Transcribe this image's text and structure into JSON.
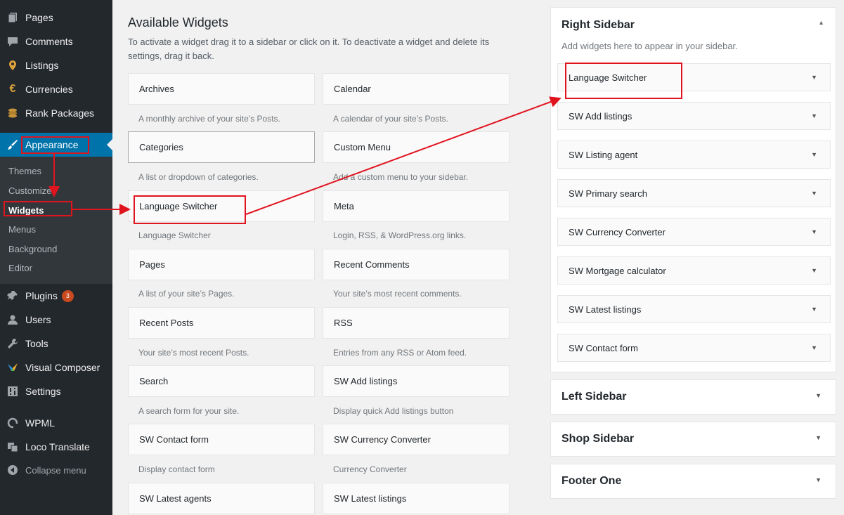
{
  "menu": {
    "pages": "Pages",
    "comments": "Comments",
    "listings": "Listings",
    "currencies": "Currencies",
    "rank_packages": "Rank Packages",
    "appearance": "Appearance",
    "plugins": "Plugins",
    "plugins_badge": "3",
    "users": "Users",
    "tools": "Tools",
    "visual_composer": "Visual Composer",
    "settings": "Settings",
    "wpml": "WPML",
    "loco_translate": "Loco Translate",
    "collapse": "Collapse menu"
  },
  "submenu": {
    "themes": "Themes",
    "customize": "Customize",
    "widgets": "Widgets",
    "menus": "Menus",
    "background": "Background",
    "editor": "Editor"
  },
  "available": {
    "title": "Available Widgets",
    "description": "To activate a widget drag it to a sidebar or click on it. To deactivate a widget and delete its settings, drag it back.",
    "widgets": [
      {
        "name": "Archives",
        "desc": "A monthly archive of your site’s Posts."
      },
      {
        "name": "Calendar",
        "desc": "A calendar of your site’s Posts."
      },
      {
        "name": "Categories",
        "desc": "A list or dropdown of categories."
      },
      {
        "name": "Custom Menu",
        "desc": "Add a custom menu to your sidebar."
      },
      {
        "name": "Language Switcher",
        "desc": "Language Switcher"
      },
      {
        "name": "Meta",
        "desc": "Login, RSS, & WordPress.org links."
      },
      {
        "name": "Pages",
        "desc": "A list of your site’s Pages."
      },
      {
        "name": "Recent Comments",
        "desc": "Your site’s most recent comments."
      },
      {
        "name": "Recent Posts",
        "desc": "Your site’s most recent Posts."
      },
      {
        "name": "RSS",
        "desc": "Entries from any RSS or Atom feed."
      },
      {
        "name": "Search",
        "desc": "A search form for your site."
      },
      {
        "name": "SW Add listings",
        "desc": "Display quick Add listings button"
      },
      {
        "name": "SW Contact form",
        "desc": "Display contact form"
      },
      {
        "name": "SW Currency Converter",
        "desc": "Currency Converter"
      },
      {
        "name": "SW Latest agents",
        "desc": ""
      },
      {
        "name": "SW Latest listings",
        "desc": ""
      }
    ]
  },
  "right_sidebar": {
    "title": "Right Sidebar",
    "description": "Add widgets here to appear in your sidebar.",
    "widgets": [
      "Language Switcher",
      "SW Add listings",
      "SW Listing agent",
      "SW Primary search",
      "SW Currency Converter",
      "SW Mortgage calculator",
      "SW Latest listings",
      "SW Contact form"
    ]
  },
  "other_sidebars": [
    "Left Sidebar",
    "Shop Sidebar",
    "Footer One"
  ],
  "colors": {
    "admin_menu_bg": "#23282d",
    "submenu_bg": "#32373c",
    "accent": "#0073aa",
    "annotation_red": "#e0141e",
    "badge": "#ca4a1f"
  }
}
